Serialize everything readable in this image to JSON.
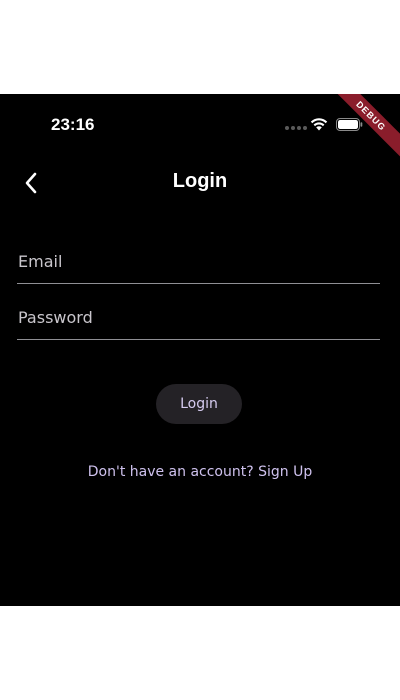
{
  "status_bar": {
    "time": "23:16",
    "debug_label": "DEBUG"
  },
  "app_bar": {
    "title": "Login",
    "back_icon": "chevron-left-icon"
  },
  "form": {
    "email_placeholder": "Email",
    "email_value": "",
    "password_placeholder": "Password",
    "password_value": "",
    "login_label": "Login",
    "signup_text": "Don't have an account? Sign Up"
  },
  "colors": {
    "background": "#000000",
    "button_bg": "#242226",
    "accent_text": "#cfc2ee",
    "debug_ribbon": "#8a1d2b"
  }
}
